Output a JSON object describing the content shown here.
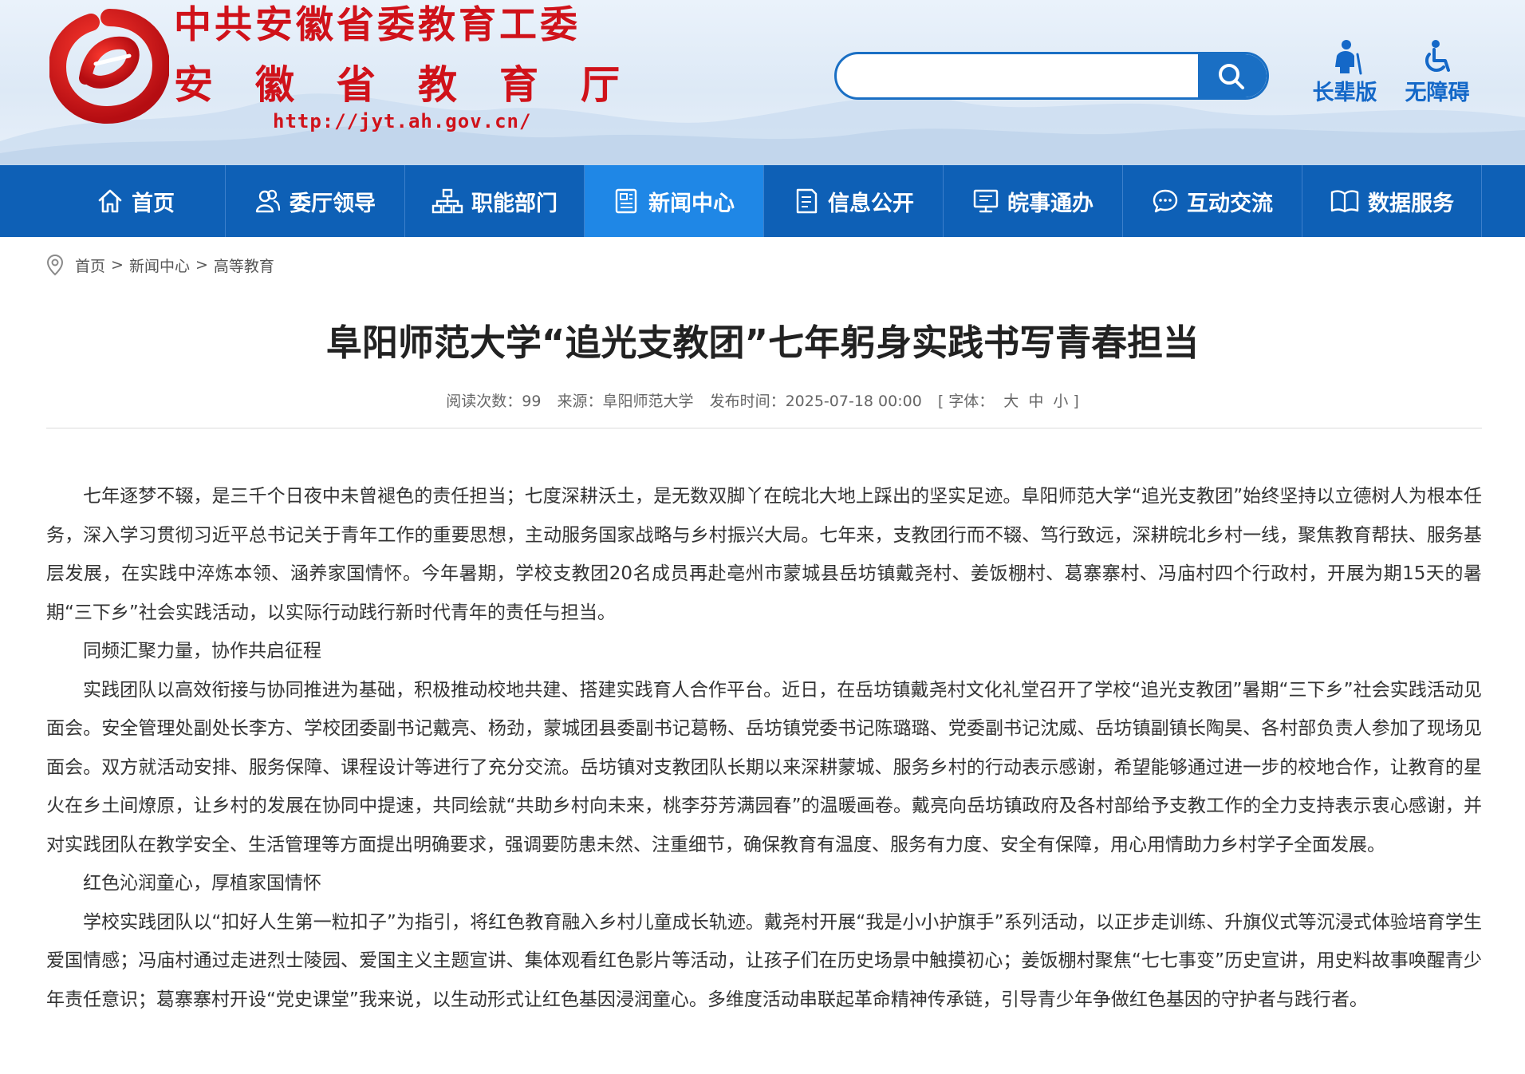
{
  "header": {
    "title_main": "中共安徽省委教育工委",
    "title_sub": "安徽省教育厅",
    "url": "http://jyt.ah.gov.cn/",
    "search_placeholder": "",
    "tools": [
      {
        "label": "长辈版",
        "icon": "elder-icon"
      },
      {
        "label": "无障碍",
        "icon": "wheelchair-icon"
      }
    ],
    "colors": {
      "brand_red": "#d0121a",
      "brand_blue": "#0e60b6",
      "active_blue": "#1f87e6"
    }
  },
  "nav": {
    "items": [
      {
        "label": "首页",
        "icon": "home-icon"
      },
      {
        "label": "委厅领导",
        "icon": "leaders-icon"
      },
      {
        "label": "职能部门",
        "icon": "org-chart-icon"
      },
      {
        "label": "新闻中心",
        "icon": "news-icon",
        "active": true
      },
      {
        "label": "信息公开",
        "icon": "document-icon"
      },
      {
        "label": "皖事通办",
        "icon": "monitor-icon"
      },
      {
        "label": "互动交流",
        "icon": "chat-icon"
      },
      {
        "label": "数据服务",
        "icon": "book-icon"
      }
    ]
  },
  "breadcrumb": {
    "items": [
      "首页",
      "新闻中心",
      "高等教育"
    ],
    "separator": ">"
  },
  "article": {
    "title": "阜阳师范大学“追光支教团”七年躬身实践书写青春担当",
    "meta": {
      "views_label": "阅读次数：",
      "views": "99",
      "source_label": "来源：",
      "source": "阜阳师范大学",
      "date_label": "发布时间：",
      "date": "2025-07-18 00:00",
      "font_label": "[ 字体：",
      "font_large": "大",
      "font_medium": "中",
      "font_small": "小",
      "font_close": "]"
    },
    "paragraphs": [
      "七年逐梦不辍，是三千个日夜中未曾褪色的责任担当；七度深耕沃土，是无数双脚丫在皖北大地上踩出的坚实足迹。阜阳师范大学“追光支教团”始终坚持以立德树人为根本任务，深入学习贯彻习近平总书记关于青年工作的重要思想，主动服务国家战略与乡村振兴大局。七年来，支教团行而不辍、笃行致远，深耕皖北乡村一线，聚焦教育帮扶、服务基层发展，在实践中淬炼本领、涵养家国情怀。今年暑期，学校支教团20名成员再赴亳州市蒙城县岳坊镇戴尧村、姜饭棚村、葛寨寨村、冯庙村四个行政村，开展为期15天的暑期“三下乡”社会实践活动，以实际行动践行新时代青年的责任与担当。",
      "同频汇聚力量，协作共启征程",
      "实践团队以高效衔接与协同推进为基础，积极推动校地共建、搭建实践育人合作平台。近日，在岳坊镇戴尧村文化礼堂召开了学校“追光支教团”暑期“三下乡”社会实践活动见面会。安全管理处副处长李方、学校团委副书记戴亮、杨劲，蒙城团县委副书记葛畅、岳坊镇党委书记陈璐璐、党委副书记沈威、岳坊镇副镇长陶昊、各村部负责人参加了现场见面会。双方就活动安排、服务保障、课程设计等进行了充分交流。岳坊镇对支教团队长期以来深耕蒙城、服务乡村的行动表示感谢，希望能够通过进一步的校地合作，让教育的星火在乡土间燎原，让乡村的发展在协同中提速，共同绘就“共助乡村向未来，桃李芬芳满园春”的温暖画卷。戴亮向岳坊镇政府及各村部给予支教工作的全力支持表示衷心感谢，并对实践团队在教学安全、生活管理等方面提出明确要求，强调要防患未然、注重细节，确保教育有温度、服务有力度、安全有保障，用心用情助力乡村学子全面发展。",
      "红色沁润童心，厚植家国情怀",
      "学校实践团队以“扣好人生第一粒扣子”为指引，将红色教育融入乡村儿童成长轨迹。戴尧村开展“我是小小护旗手”系列活动，以正步走训练、升旗仪式等沉浸式体验培育学生爱国情感；冯庙村通过走进烈士陵园、爱国主义主题宣讲、集体观看红色影片等活动，让孩子们在历史场景中触摸初心；姜饭棚村聚焦“七七事变”历史宣讲，用史料故事唤醒青少年责任意识；葛寨寨村开设“党史课堂”我来说，以生动形式让红色基因浸润童心。多维度活动串联起革命精神传承链，引导青少年争做红色基因的守护者与践行者。"
    ]
  }
}
